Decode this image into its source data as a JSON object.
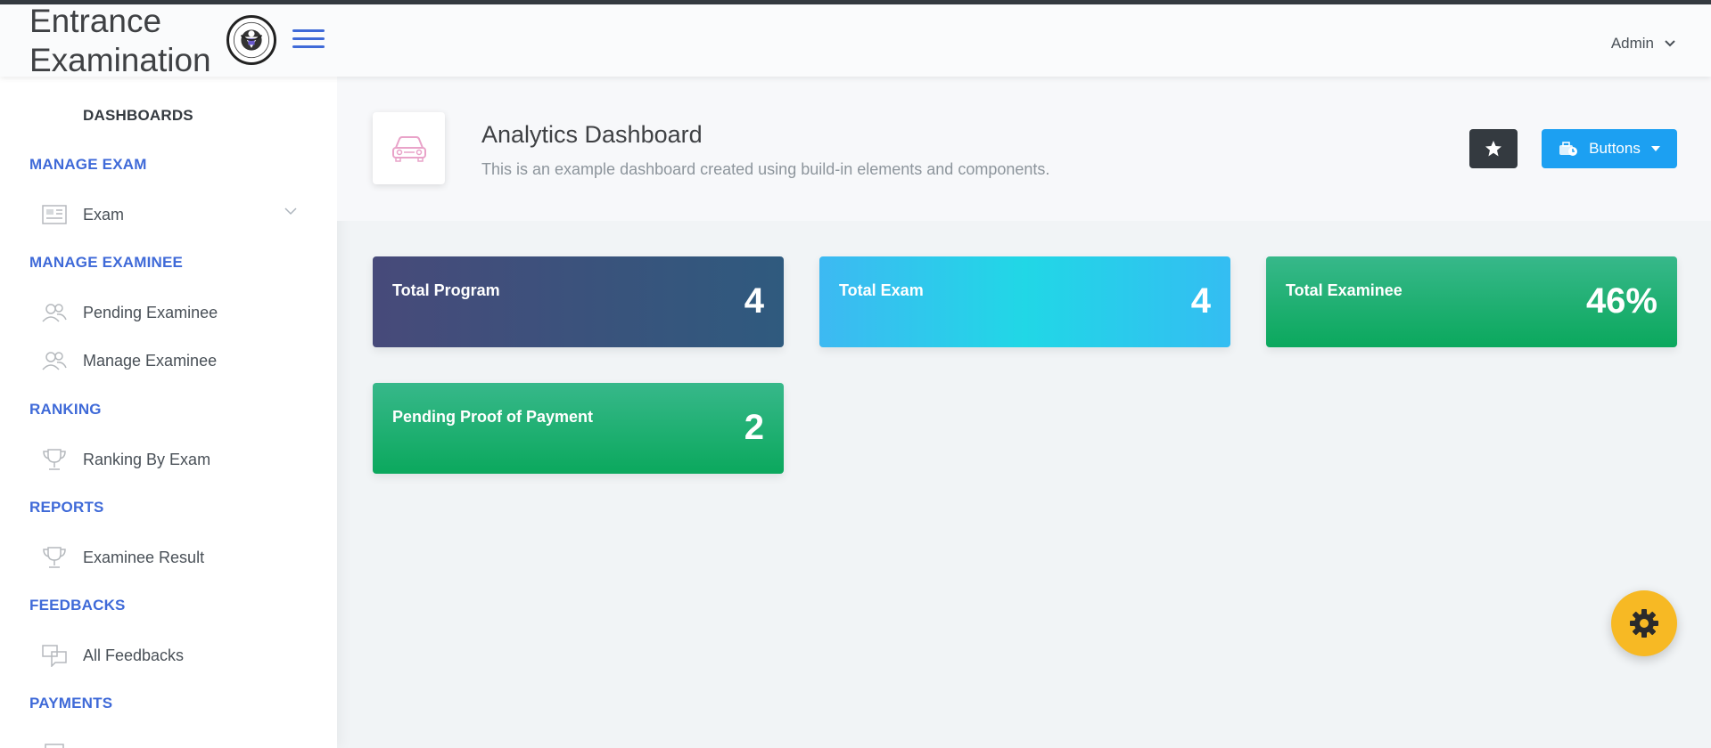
{
  "header": {
    "title_line1": "Entrance",
    "title_line2": "Examination",
    "user_name": "Admin"
  },
  "sidebar": {
    "dashboards_label": "DASHBOARDS",
    "sections": [
      {
        "heading": "MANAGE EXAM",
        "items": [
          {
            "label": "Exam",
            "icon": "newspaper-icon",
            "has_chevron": true
          }
        ]
      },
      {
        "heading": "MANAGE EXAMINEE",
        "items": [
          {
            "label": "Pending Examinee",
            "icon": "users-icon"
          },
          {
            "label": "Manage Examinee",
            "icon": "users-icon"
          }
        ]
      },
      {
        "heading": "RANKING",
        "items": [
          {
            "label": "Ranking By Exam",
            "icon": "trophy-icon"
          }
        ]
      },
      {
        "heading": "REPORTS",
        "items": [
          {
            "label": "Examinee Result",
            "icon": "trophy-icon"
          }
        ]
      },
      {
        "heading": "FEEDBACKS",
        "items": [
          {
            "label": "All Feedbacks",
            "icon": "chat-icon"
          }
        ]
      },
      {
        "heading": "PAYMENTS",
        "items": []
      }
    ]
  },
  "page_title": {
    "heading": "Analytics Dashboard",
    "subheading": "This is an example dashboard created using build-in elements and components.",
    "icon": "car-icon",
    "star_icon": "star-icon",
    "buttons_label": "Buttons",
    "buttons_icon": "business-time-icon"
  },
  "cards": [
    {
      "title": "Total Program",
      "value": "4"
    },
    {
      "title": "Total Exam",
      "value": "4"
    },
    {
      "title": "Total Examinee",
      "value": "46%"
    },
    {
      "title": "Pending Proof of Payment",
      "value": "2"
    }
  ],
  "colors": {
    "accent": "#3f6ad8",
    "dark": "#343a40",
    "info": "#1ca0f2",
    "warning": "#f7b924",
    "success": "#0ba85d"
  },
  "settings_icon": "gear-icon"
}
